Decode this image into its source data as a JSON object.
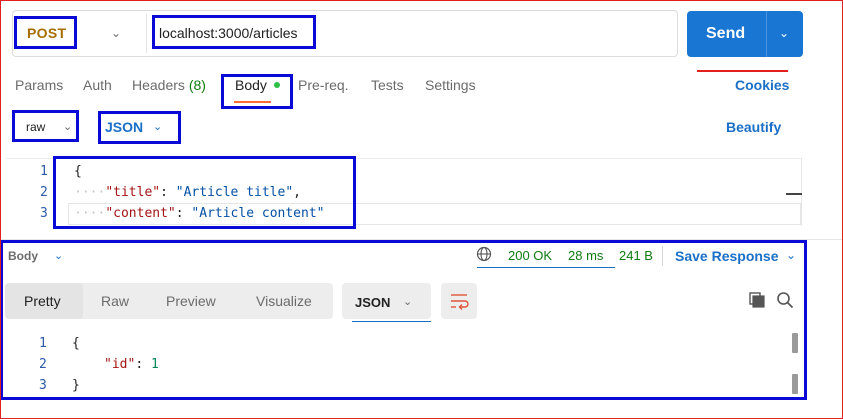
{
  "request": {
    "method": "POST",
    "url": "localhost:3000/articles",
    "send_label": "Send"
  },
  "tabs": [
    {
      "label": "Params"
    },
    {
      "label": "Auth"
    },
    {
      "label": "Headers",
      "count": "(8)"
    },
    {
      "label": "Body",
      "active": true
    },
    {
      "label": "Pre-req."
    },
    {
      "label": "Tests"
    },
    {
      "label": "Settings"
    }
  ],
  "cookies_label": "Cookies",
  "body_options": {
    "mode": "raw",
    "language": "JSON",
    "beautify_label": "Beautify"
  },
  "request_body": {
    "line_numbers": [
      "1",
      "2",
      "3"
    ],
    "line1": "{",
    "line2": {
      "dots": "····",
      "key": "\"title\"",
      "sep": ": ",
      "value": "\"Article title\"",
      "end": ","
    },
    "line3": {
      "dots": "····",
      "key": "\"content\"",
      "sep": ": ",
      "value": "\"Article content\""
    }
  },
  "response": {
    "title": "Body",
    "status": "200 OK",
    "time": "28 ms",
    "size": "241 B",
    "save_label": "Save Response",
    "views": [
      "Pretty",
      "Raw",
      "Preview",
      "Visualize"
    ],
    "active_view": "Pretty",
    "format": "JSON",
    "line_numbers": [
      "1",
      "2",
      "3"
    ],
    "line1": "{",
    "line2": {
      "key": "\"id\"",
      "sep": ": ",
      "value": "1"
    },
    "line3": "}"
  },
  "colors": {
    "accent": "#1976d2",
    "method": "#a66e00",
    "success": "#0f7b0f",
    "highlight_box": "#0a0ad6",
    "frame": "#e32020"
  },
  "icons": [
    "chevron-down-icon",
    "globe-icon",
    "wrap-lines-icon",
    "copy-icon",
    "search-icon"
  ]
}
